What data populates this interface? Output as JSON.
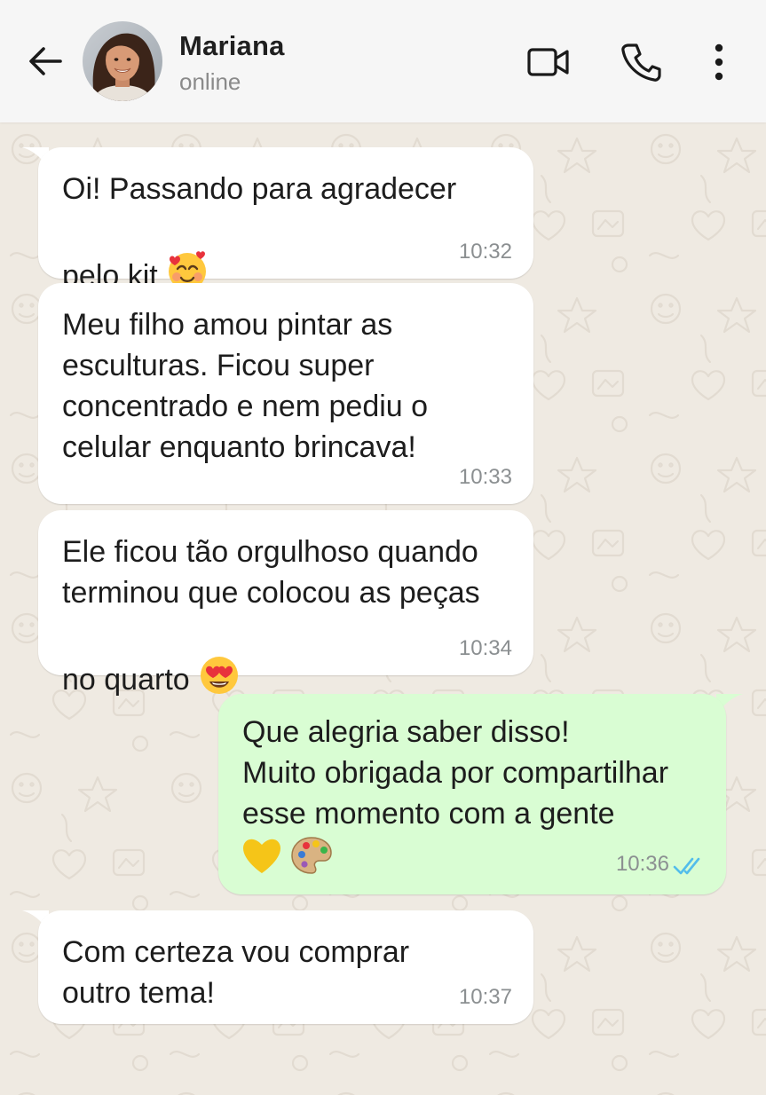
{
  "header": {
    "back_icon": "arrow-left-icon",
    "contact_name": "Mariana",
    "contact_status": "online",
    "video_icon": "video-camera-icon",
    "call_icon": "phone-icon",
    "menu_icon": "more-vertical-icon"
  },
  "messages": [
    {
      "direction": "incoming",
      "text": "Oi! Passando para agradecer\npelo kit",
      "emoji": "smiling-face-with-hearts",
      "time": "10:32"
    },
    {
      "direction": "incoming",
      "text": "Meu filho amou pintar as\nesculturas. Ficou super\nconcentrado e nem pediu o\ncelular enquanto brincava!",
      "time": "10:33"
    },
    {
      "direction": "incoming",
      "text": "Ele ficou tão orgulhoso quando\nterminou que colocou as peças\nno quarto",
      "emoji": "heart-eyes",
      "time": "10:34"
    },
    {
      "direction": "outgoing",
      "text": "Que alegria saber disso!\nMuito obrigada por compartilhar\nesse momento com a gente",
      "emoji": "yellow-heart + artist-palette",
      "time": "10:36",
      "status": "read"
    },
    {
      "direction": "incoming",
      "text": "Com certeza vou comprar\noutro tema!",
      "time": "10:37"
    }
  ],
  "colors": {
    "chat_background": "#efeae2",
    "incoming_bubble": "#ffffff",
    "outgoing_bubble": "#d9fdd3",
    "read_ticks": "#53bdeb",
    "timestamp": "#8b8f91"
  }
}
